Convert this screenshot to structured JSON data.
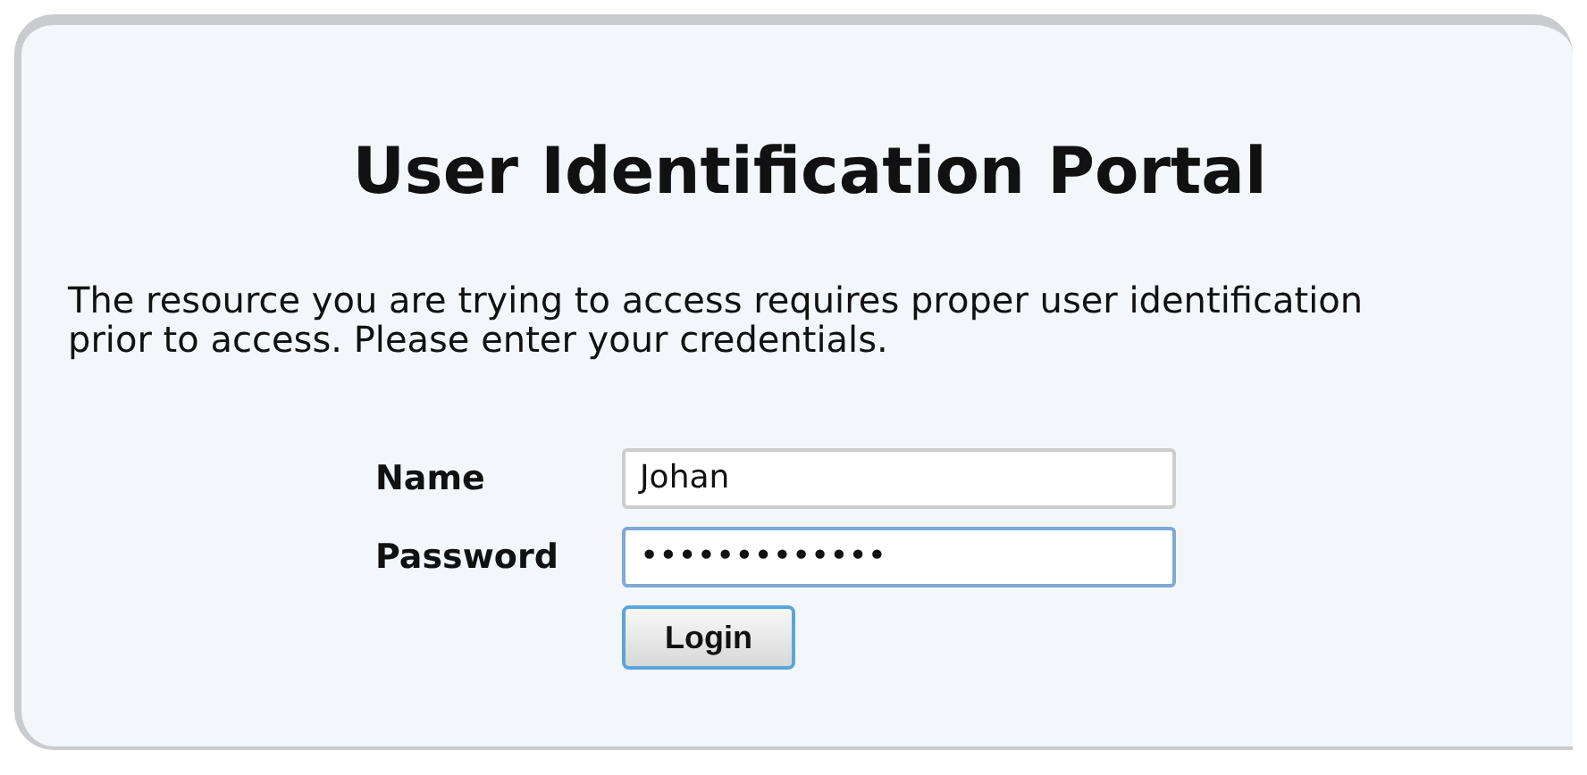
{
  "title": "User Identification Portal",
  "message": "The resource you are trying to access requires proper user identification prior to access. Please enter your credentials.",
  "fields": [
    {
      "label": "Name",
      "value": "Johan",
      "focused": false
    },
    {
      "label": "Password",
      "value": "•••••••••••••",
      "focused": true
    }
  ],
  "button": "Login"
}
